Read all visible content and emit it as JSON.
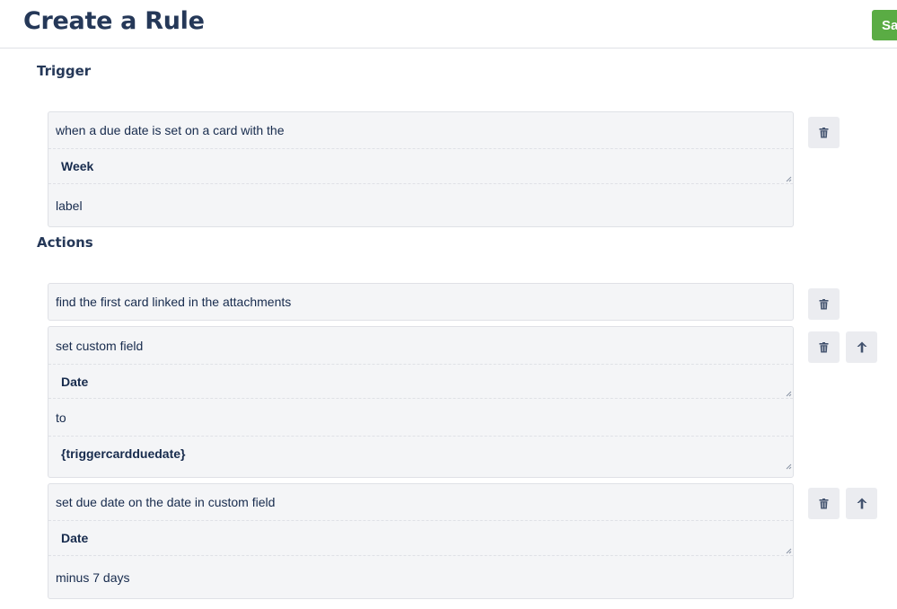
{
  "header": {
    "title": "Create a Rule",
    "save_label": "Sa"
  },
  "trigger": {
    "label": "Trigger",
    "card": {
      "line1": "when a due date is set on a card with the",
      "field": "Week",
      "line2": "label"
    }
  },
  "actions": {
    "label": "Actions",
    "items": [
      {
        "line1": "find the first card linked in the attachments"
      },
      {
        "line1": "set custom field",
        "field1": "Date",
        "line2": "to",
        "field2": "{triggercardduedate}"
      },
      {
        "line1": "set due date on the date in custom field",
        "field1": "Date",
        "line2": "minus 7 days"
      }
    ]
  },
  "icons": {
    "delete": "trash-icon",
    "move_up": "arrow-up-icon",
    "resize": "resize-handle-icon"
  },
  "colors": {
    "save_button": "#5aac44",
    "title": "#253858",
    "card_bg": "#f4f5f7",
    "icon_button_bg": "#ebecf0"
  }
}
